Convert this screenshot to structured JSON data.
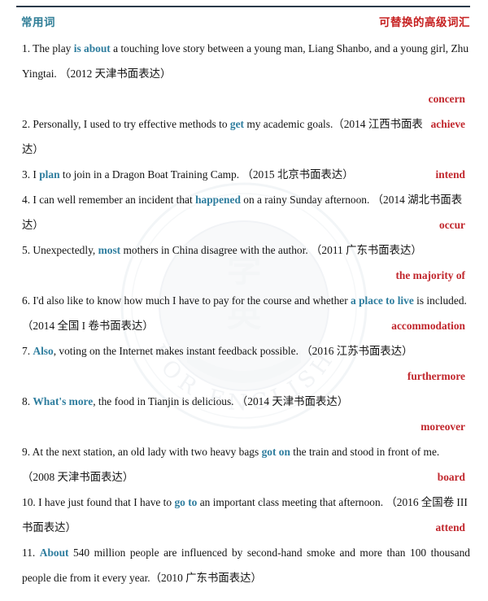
{
  "document": {
    "type": "vocabulary-upgrade-table",
    "headers": {
      "left": "常用词",
      "right": "可替换的高级词汇"
    },
    "colors": {
      "header_left": "#2e7d96",
      "header_right": "#c62020",
      "common_word": "#2e7d9e",
      "advanced_word": "#c1272d",
      "rule": "#2b3a4a",
      "body_text": "#141414"
    },
    "watermark": {
      "text_outer": "FOR ENGLISH",
      "visible": true
    }
  },
  "entries": [
    {
      "number": "1.",
      "before": "The play ",
      "word": "is about",
      "after": " a touching love story between a young man, Liang Shanbo, and a young girl, Zhu Yingtai. （2012 天津书面表达）",
      "answer": "concern"
    },
    {
      "number": "2.",
      "before": "Personally, I used to try effective methods to ",
      "word": "get",
      "after": " my academic goals.（2014 江西书面表达）",
      "answer": "achieve"
    },
    {
      "number": "3.",
      "before": "I ",
      "word": "plan",
      "after": " to join in a Dragon Boat Training Camp. （2015 北京书面表达）",
      "answer": "intend"
    },
    {
      "number": "4.",
      "before": "I can well remember an incident that ",
      "word": "happened",
      "after": " on a rainy Sunday afternoon. （2014 湖北书面表达）",
      "answer": "occur"
    },
    {
      "number": "5.",
      "before": "Unexpectedly, ",
      "word": "most",
      "after": " mothers in China disagree with the author. （2011 广东书面表达）",
      "answer": "the majority of"
    },
    {
      "number": "6.",
      "before": "I'd also like to know how much I have to pay for the course and whether ",
      "word": "a place to live",
      "after": " is included. （2014 全国 I 卷书面表达）",
      "answer": "accommodation"
    },
    {
      "number": "7.",
      "before": "",
      "word": "Also",
      "after": ", voting on the Internet makes instant feedback possible. （2016 江苏书面表达）",
      "answer": "furthermore"
    },
    {
      "number": "8.",
      "before": "",
      "word": "What's more",
      "after": ", the food in Tianjin is delicious. （2014 天津书面表达）",
      "answer": "moreover"
    },
    {
      "number": "9.",
      "before": "At the next station, an old lady with two heavy bags ",
      "word": "got on",
      "after": " the train and stood in front of me. （2008 天津书面表达）",
      "answer": "board"
    },
    {
      "number": "10.",
      "before": "I have just found that I have to ",
      "word": "go to",
      "after": " an important class meeting that afternoon. （2016 全国卷 III 书面表达）",
      "answer": "attend"
    },
    {
      "number": "11.",
      "before": "",
      "word": "About",
      "after": " 540 million people are influenced by second-hand smoke and more than 100 thousand people die from it every year.（2010 广东书面表达）",
      "answer": ""
    }
  ]
}
